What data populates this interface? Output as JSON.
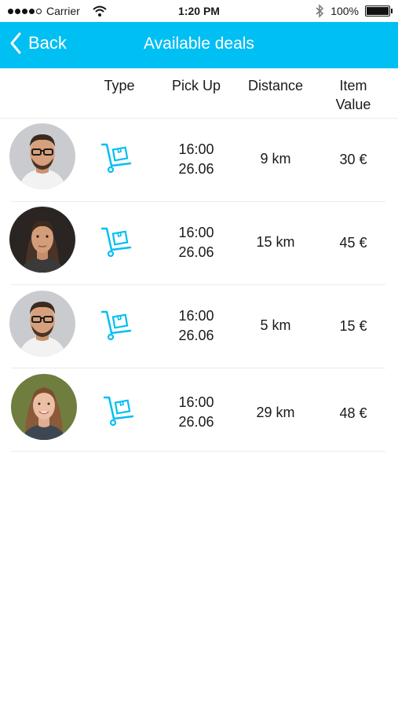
{
  "status_bar": {
    "carrier": "Carrier",
    "time": "1:20 PM",
    "battery": "100%"
  },
  "nav": {
    "back_label": "Back",
    "title": "Available deals"
  },
  "header": {
    "type": "Type",
    "pickup": "Pick Up",
    "distance": "Distance",
    "value_line1": "Item",
    "value_line2": "Value"
  },
  "accent_color": "#00bff3",
  "deals": [
    {
      "type_icon": "cart-icon",
      "pickup_time": "16:00",
      "pickup_date": "26.06",
      "distance": "9 km",
      "value": "30 €"
    },
    {
      "type_icon": "cart-icon",
      "pickup_time": "16:00",
      "pickup_date": "26.06",
      "distance": "15 km",
      "value": "45 €"
    },
    {
      "type_icon": "cart-icon",
      "pickup_time": "16:00",
      "pickup_date": "26.06",
      "distance": "5 km",
      "value": "15 €"
    },
    {
      "type_icon": "cart-icon",
      "pickup_time": "16:00",
      "pickup_date": "26.06",
      "distance": "29 km",
      "value": "48 €"
    }
  ]
}
